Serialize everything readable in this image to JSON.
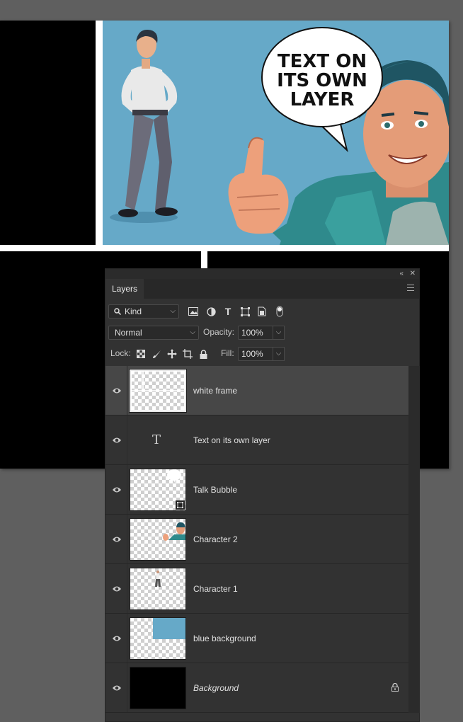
{
  "speech_bubble": {
    "line1": "TEXT ON",
    "line2": "ITS OWN",
    "line3": "LAYER"
  },
  "panel": {
    "tab_label": "Layers",
    "filter": {
      "value": "Kind",
      "icon": "search-icon"
    },
    "filter_icons": [
      "image-filter-icon",
      "adjustment-filter-icon",
      "type-filter-icon",
      "shape-filter-icon",
      "smart-object-filter-icon",
      "filter-toggle-icon"
    ],
    "blend_mode": "Normal",
    "opacity_label": "Opacity:",
    "opacity_value": "100%",
    "lock_label": "Lock:",
    "lock_icons": [
      "lock-transparent-pixels-icon",
      "lock-image-pixels-icon",
      "lock-position-icon",
      "lock-artboard-icon",
      "lock-all-icon"
    ],
    "fill_label": "Fill:",
    "fill_value": "100%"
  },
  "layers": [
    {
      "name": "white frame",
      "selected": true,
      "visible": true
    },
    {
      "name": "Text on its own layer",
      "type": "text",
      "visible": true
    },
    {
      "name": "Talk Bubble",
      "smart_object": true,
      "visible": true
    },
    {
      "name": "Character 2",
      "visible": true
    },
    {
      "name": "Character 1",
      "visible": true
    },
    {
      "name": "blue background",
      "visible": true
    },
    {
      "name": "Background",
      "italic": true,
      "locked": true,
      "visible": true
    }
  ],
  "colors": {
    "sky_blue": "#66a9c8",
    "canvas_black": "#000000",
    "frame_white": "#ffffff",
    "panel_bg": "#323232",
    "selected_row": "#474747",
    "workspace": "#5f5f5f"
  }
}
